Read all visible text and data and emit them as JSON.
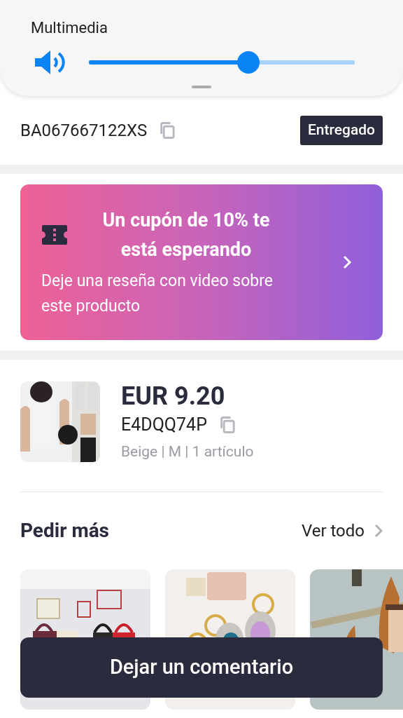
{
  "volume_panel": {
    "label": "Multimedia",
    "level": 0.6
  },
  "order": {
    "number": "BA067667122XS",
    "status": "Entregado"
  },
  "coupon": {
    "title": "Un cupón de 10% te está esperando",
    "subtitle": "Deje una reseña con video sobre este producto"
  },
  "product": {
    "price": "EUR 9.20",
    "code": "E4DQQ74P",
    "details": "Beige | M | 1 artículo"
  },
  "more": {
    "title": "Pedir más",
    "link": "Ver todo"
  },
  "action_button": "Dejar un comentario"
}
